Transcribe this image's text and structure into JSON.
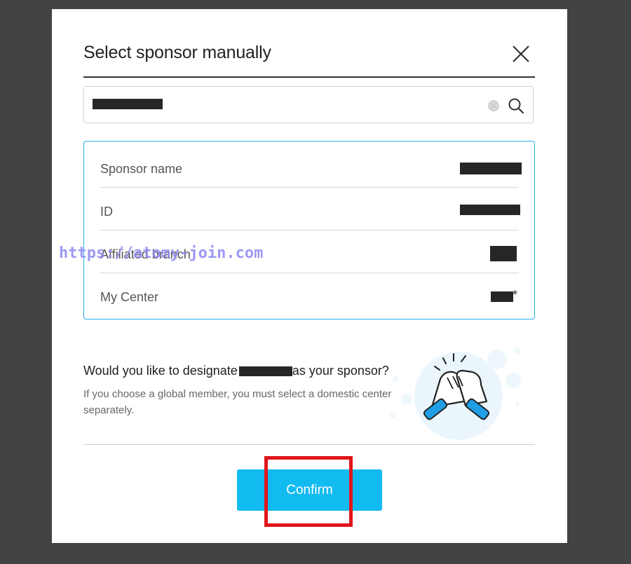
{
  "modal": {
    "title": "Select sponsor manually",
    "close_icon": "close-icon"
  },
  "search": {
    "clear_icon": "clear-icon",
    "search_icon": "search-icon"
  },
  "sponsor": {
    "rows": [
      {
        "label": "Sponsor name"
      },
      {
        "label": "ID"
      },
      {
        "label": "Affiliated branch"
      },
      {
        "label": "My Center"
      }
    ],
    "center_suffix": "*"
  },
  "watermark": "https://atomy-join.com",
  "prompt": {
    "question_start": "Would you like to designate",
    "question_end": "as your sponsor?",
    "note": "If you choose a global member, you must select a domestic center separately.",
    "illustration_icon": "handshake-icon"
  },
  "actions": {
    "confirm_label": "Confirm"
  },
  "colors": {
    "accent": "#11bbf0",
    "panel_border": "#1fb2e8",
    "highlight": "#e0151b",
    "backdrop": "#424343",
    "watermark": "#8c88f2"
  }
}
